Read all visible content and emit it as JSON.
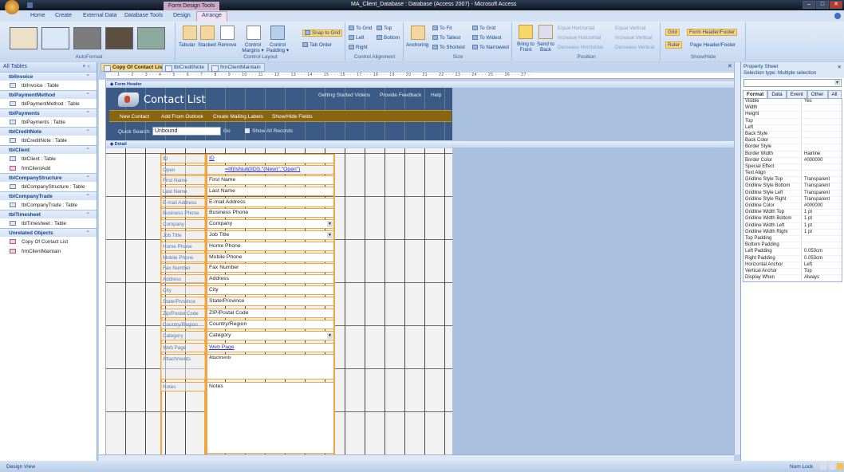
{
  "window": {
    "title": "MA_Client_Database : Database (Access 2007) - Microsoft Access",
    "context_tab": "Form Design Tools",
    "controls": [
      "–",
      "□",
      "✕"
    ]
  },
  "ribbon_tabs": [
    "Home",
    "Create",
    "External Data",
    "Database Tools",
    "Design",
    "Arrange"
  ],
  "ribbon": {
    "autoformat": {
      "label": "AutoFormat"
    },
    "control_layout": {
      "label": "Control Layout",
      "tabular": "Tabular",
      "stacked": "Stacked",
      "remove": "Remove",
      "margins": "Control Margins ▾",
      "padding": "Control Padding ▾",
      "snap": "Snap to Grid",
      "tab_order": "Tab Order"
    },
    "control_alignment": {
      "label": "Control Alignment",
      "to_grid": "To Grid",
      "top": "Top",
      "left": "Left",
      "bottom": "Bottom",
      "right": "Right"
    },
    "size": {
      "label": "Size",
      "anchoring": "Anchoring",
      "to_fit": "To Fit",
      "to_tallest": "To Tallest",
      "to_shortest": "To Shortest",
      "to_grid": "To Grid",
      "to_widest": "To Widest",
      "to_narrowest": "To Narrowest"
    },
    "position": {
      "label": "Position",
      "bring_front": "Bring to Front",
      "send_back": "Send to Back",
      "eq_h": "Equal Horizontal",
      "inc_h": "Increase Horizontal",
      "dec_h": "Decrease Horizontal",
      "eq_v": "Equal Vertical",
      "inc_v": "Increase Vertical",
      "dec_v": "Decrease Vertical"
    },
    "show_hide": {
      "label": "Show/Hide",
      "grid": "Grid",
      "form_hf": "Form Header/Footer",
      "ruler": "Ruler",
      "page_hf": "Page Header/Footer"
    }
  },
  "nav": {
    "title": "All Tables",
    "groups": [
      {
        "name": "tblInvoice",
        "items": [
          {
            "label": "tblInvoice : Table",
            "type": "table"
          }
        ]
      },
      {
        "name": "tblPaymentMethod",
        "items": [
          {
            "label": "tblPaymentMethod : Table",
            "type": "table"
          }
        ]
      },
      {
        "name": "tblPayments",
        "items": [
          {
            "label": "tblPayments : Table",
            "type": "table"
          }
        ]
      },
      {
        "name": "tblCreditNote",
        "items": [
          {
            "label": "tblCreditNote : Table",
            "type": "table"
          }
        ]
      },
      {
        "name": "tblClient",
        "items": [
          {
            "label": "tblClient : Table",
            "type": "table"
          },
          {
            "label": "frmClientAdd",
            "type": "form"
          }
        ]
      },
      {
        "name": "tblCompanyStructure",
        "items": [
          {
            "label": "tblCompanyStructure : Table",
            "type": "table"
          }
        ]
      },
      {
        "name": "tblCompanyTrade",
        "items": [
          {
            "label": "tblCompanyTrade : Table",
            "type": "table"
          }
        ]
      },
      {
        "name": "tblTimesheet",
        "items": [
          {
            "label": "tblTimesheet : Table",
            "type": "table"
          }
        ]
      },
      {
        "name": "Unrelated Objects",
        "items": [
          {
            "label": "Copy Of Contact List",
            "type": "form"
          },
          {
            "label": "frmClientMaintain",
            "type": "form"
          }
        ]
      }
    ]
  },
  "doc_tabs": [
    "Copy Of Contact List",
    "tblCreditNote",
    "frmClientMaintain"
  ],
  "ruler_text": "· · · 1 · · · 2 · · · 3 · · · 4 · · · 5 · · · 6 · · · 7 · · · 8 · · · 9 · · · 10 · · · 11 · · · 12 · · · 13 · · · 14 · · · 15 · · · 16 · · · 17 · · · 18 · · · 19 · · · 20 · · · 21 · · · 22 · · · 23 · · · 24 · · · 25 · · · 26 · · · 27 · ·",
  "form": {
    "header_section": "Form Header",
    "detail_section": "Detail",
    "title": "Contact List",
    "header_links": [
      "Getting Started Videos",
      "Provide Feedback",
      "Help"
    ],
    "buttons": [
      "New Contact",
      "Add From Outlook",
      "Create Mailing Labels",
      "Show/Hide Fields"
    ],
    "quick_search_label": "Quick Search:",
    "quick_search_value": "Unbound",
    "go": "Go",
    "show_all": "Show All Records",
    "fields": [
      {
        "label": "ID",
        "control": "ID",
        "kind": "link"
      },
      {
        "label": "Open",
        "control": "=IIf(IsNull([ID]),\"(New)\",\"Open\")",
        "kind": "link"
      },
      {
        "label": "First Name",
        "control": "First Name"
      },
      {
        "label": "Last Name",
        "control": "Last Name"
      },
      {
        "label": "E-mail Address",
        "control": "E-mail Address"
      },
      {
        "label": "Business Phone",
        "control": "Business Phone"
      },
      {
        "label": "Company",
        "control": "Company",
        "kind": "combo"
      },
      {
        "label": "Job Title",
        "control": "Job Title",
        "kind": "combo"
      },
      {
        "label": "Home Phone",
        "control": "Home Phone"
      },
      {
        "label": "Mobile Phone",
        "control": "Mobile Phone"
      },
      {
        "label": "Fax Number",
        "control": "Fax Number"
      },
      {
        "label": "Address",
        "control": "Address"
      },
      {
        "label": "City",
        "control": "City"
      },
      {
        "label": "State/Province",
        "control": "State/Province"
      },
      {
        "label": "Zip/Postal Code",
        "control": "ZIP/Postal Code"
      },
      {
        "label": "Country/Region",
        "control": "Country/Region"
      },
      {
        "label": "Category",
        "control": "Category",
        "kind": "combo"
      },
      {
        "label": "Web Page",
        "control": "Web Page",
        "kind": "link"
      },
      {
        "label": "Attachments",
        "control": "Attachments",
        "kind": "attach"
      },
      {
        "label": "Notes",
        "control": "Notes",
        "kind": "notes"
      }
    ]
  },
  "property_sheet": {
    "title": "Property Sheet",
    "selection": "Selection type:  Multiple selection",
    "tabs": [
      "Format",
      "Data",
      "Event",
      "Other",
      "All"
    ],
    "rows": [
      [
        "Visible",
        "Yes"
      ],
      [
        "Width",
        ""
      ],
      [
        "Height",
        ""
      ],
      [
        "Top",
        ""
      ],
      [
        "Left",
        ""
      ],
      [
        "Back Style",
        ""
      ],
      [
        "Back Color",
        ""
      ],
      [
        "Border Style",
        ""
      ],
      [
        "Border Width",
        "Hairline"
      ],
      [
        "Border Color",
        "#000000"
      ],
      [
        "Special Effect",
        ""
      ],
      [
        "Text Align",
        ""
      ],
      [
        "Gridline Style Top",
        "Transparent"
      ],
      [
        "Gridline Style Bottom",
        "Transparent"
      ],
      [
        "Gridline Style Left",
        "Transparent"
      ],
      [
        "Gridline Style Right",
        "Transparent"
      ],
      [
        "Gridline Color",
        "#000000"
      ],
      [
        "Gridline Width Top",
        "1 pt"
      ],
      [
        "Gridline Width Bottom",
        "1 pt"
      ],
      [
        "Gridline Width Left",
        "1 pt"
      ],
      [
        "Gridline Width Right",
        "1 pt"
      ],
      [
        "Top Padding",
        ""
      ],
      [
        "Bottom Padding",
        ""
      ],
      [
        "Left Padding",
        "0.053cm"
      ],
      [
        "Right Padding",
        "0.053cm"
      ],
      [
        "Horizontal Anchor",
        "Left"
      ],
      [
        "Vertical Anchor",
        "Top"
      ],
      [
        "Display When",
        "Always"
      ]
    ]
  },
  "status": {
    "left": "Design View",
    "right": "Num Lock"
  }
}
